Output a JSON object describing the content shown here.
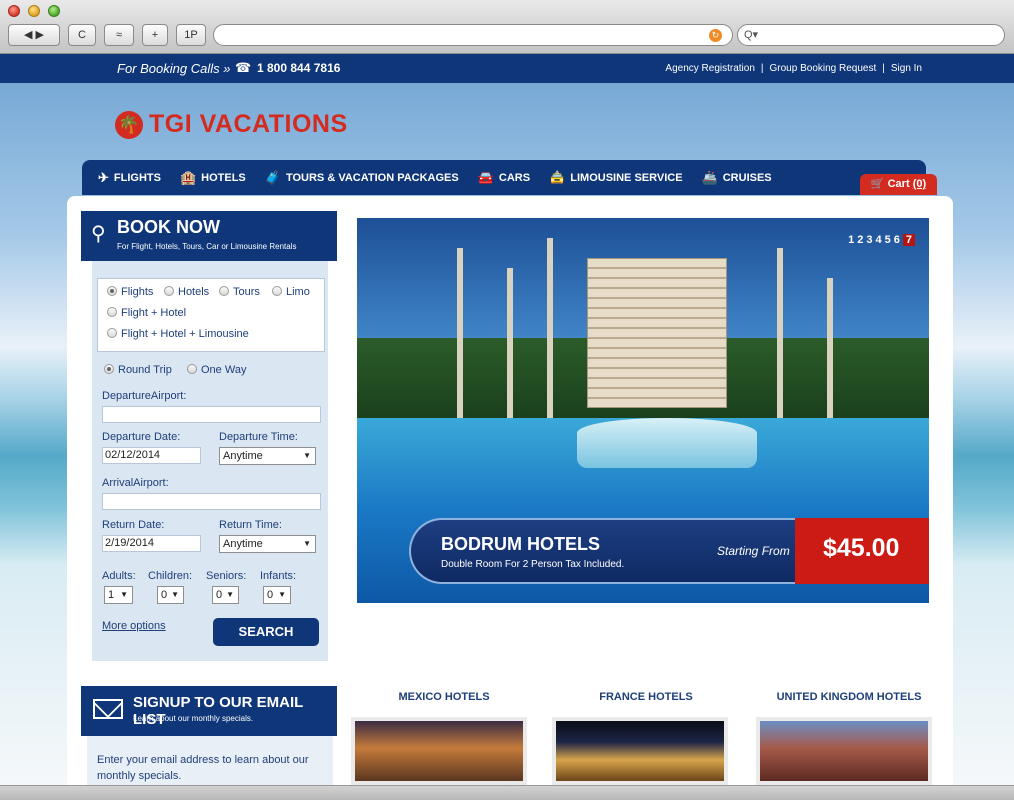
{
  "browser": {
    "buttons": [
      "◀ ▶",
      "C",
      "≈",
      "+",
      "1P"
    ],
    "search_placeholder": "Q▾"
  },
  "topbar": {
    "booking_calls": "For Booking Calls »",
    "phone_number": "1 800 844 7816",
    "links": [
      "Agency Registration",
      "Group Booking Request",
      "Sign In"
    ],
    "separator": "|"
  },
  "logo": {
    "text": "TGI VACATIONS",
    "icon": "palm-tree-icon"
  },
  "nav": {
    "items": [
      {
        "label": "FLIGHTS",
        "icon": "✈"
      },
      {
        "label": "HOTELS",
        "icon": "🏨"
      },
      {
        "label": "TOURS & VACATION PACKAGES",
        "icon": "🧳"
      },
      {
        "label": "CARS",
        "icon": "🚘"
      },
      {
        "label": "LIMOUSINE SERVICE",
        "icon": "🚖"
      },
      {
        "label": "CRUISES",
        "icon": "🚢"
      }
    ],
    "cart_label": "Cart",
    "cart_count": "(0)"
  },
  "booknow": {
    "title": "BOOK NOW",
    "subtitle": "For Flight, Hotels, Tours, Car or Limousine Rentals",
    "types": [
      "Flights",
      "Hotels",
      "Tours",
      "Limo",
      "Flight + Hotel",
      "Flight + Hotel + Limousine"
    ],
    "trip": [
      "Round Trip",
      "One Way"
    ],
    "departure_airport_label": "DepartureAirport:",
    "departure_date_label": "Departure Date:",
    "departure_date_value": "02/12/2014",
    "departure_time_label": "Departure Time:",
    "departure_time_value": "Anytime",
    "arrival_airport_label": "ArrivalAirport:",
    "return_date_label": "Return Date:",
    "return_date_value": "2/19/2014",
    "return_time_label": "Return Time:",
    "return_time_value": "Anytime",
    "adults_label": "Adults:",
    "adults_value": "1",
    "children_label": "Children:",
    "children_value": "0",
    "seniors_label": "Seniors:",
    "seniors_value": "0",
    "infants_label": "Infants:",
    "infants_value": "0",
    "more_options": "More options",
    "search": "SEARCH"
  },
  "signup": {
    "title": "SIGNUP TO OUR EMAIL LIST",
    "subtitle": "Learn about our monthly specials.",
    "text": "Enter your email address to learn about our monthly specials."
  },
  "hero": {
    "pager": [
      "1",
      "2",
      "3",
      "4",
      "5",
      "6",
      "7"
    ],
    "current_page": "7",
    "title": "BODRUM HOTELS",
    "subtitle": "Double Room For 2 Person Tax Included.",
    "starting_from": "Starting From",
    "price": "$45.00"
  },
  "categories": [
    "MEXICO HOTELS",
    "FRANCE HOTELS",
    "UNITED KINGDOM HOTELS"
  ]
}
